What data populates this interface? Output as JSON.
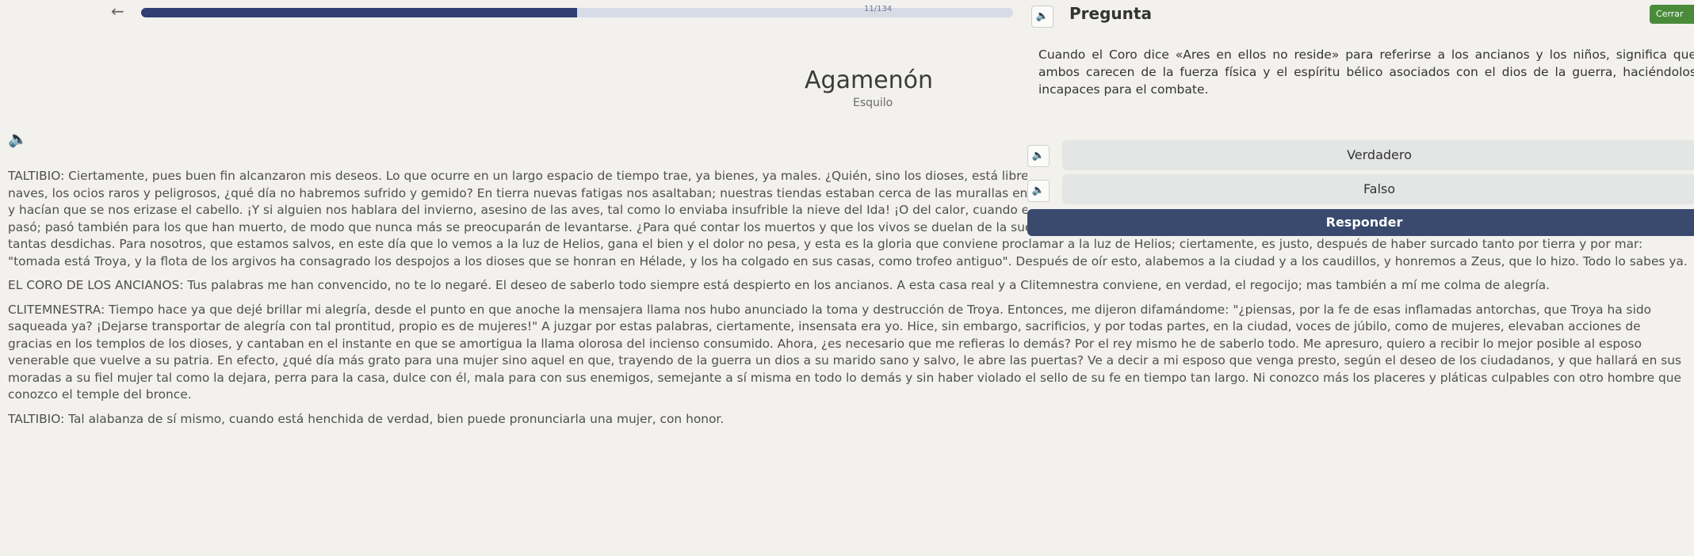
{
  "header": {
    "back_icon": "back-arrow-icon",
    "progress_text": "11/134",
    "progress": 0.5
  },
  "book": {
    "title": "Agamenón",
    "author": "Esquilo",
    "audio_icon": "speaker-icon",
    "paragraphs": [
      "TALTIBIO: Ciertamente, pues buen fin alcanzaron mis deseos. Lo que ocurre en un largo espacio de tiempo trae, ya bienes, ya males. ¿Quién, sino los dioses, está libre de dolor todo el tiempo de su vida? Si os contara nuestras fatigas y el mal acampar, los accidentes de las naves, los ocios raros y peligrosos, ¿qué día no habremos sufrido y gemido? En tierra nuevas fatigas nos asaltaban; nuestras tiendas estaban cerca de las murallas enemigas; del cielo y de la tierra, los rocíos de los prados nos empapaban, calamidad de nuestras vestiduras, y hacían que se nos erizase el cabello. ¡Y si alguien nos hablara del invierno, asesino de las aves, tal como lo enviaba insufrible la nieve del Ida! ¡O del calor, cuando el mar, abandonado por el viento, se dormía inmóvil en su lecho! Pero ¿para qué quejarse ya? El trabajo pasó; pasó también para los que han muerto, de modo que nunca más se preocuparán de levantarse. ¿Para qué contar los muertos y que los vivos se duelan de la suerte adversa? ¿De qué les sirve contarlo a los vivos? Antes conviene regocijarse de haber escapado de tantas desdichas. Para nosotros, que estamos salvos, en este día que lo vemos a la luz de Helios, gana el bien y el dolor no pesa, y esta es la gloria que conviene proclamar a la luz de Helios; ciertamente, es justo, después de haber surcado tanto por tierra y por mar: \"tomada está Troya, y la flota de los argivos ha consagrado los despojos a los dioses que se honran en Hélade, y los ha colgado en sus casas, como trofeo antiguo\". Después de oír esto, alabemos a la ciudad y a los caudillos, y honremos a Zeus, que lo hizo. Todo lo sabes ya.",
      "EL CORO DE LOS ANCIANOS: Tus palabras me han convencido, no te lo negaré. El deseo de saberlo todo siempre está despierto en los ancianos. A esta casa real y a Clitemnestra conviene, en verdad, el regocijo; mas también a mí me colma de alegría.",
      "CLITEMNESTRA: Tiempo hace ya que dejé brillar mi alegría, desde el punto en que anoche la mensajera llama nos hubo anunciado la toma y destrucción de Troya. Entonces, me dijeron difamándome: \"¿piensas, por la fe de esas inflamadas antorchas, que Troya ha sido saqueada ya? ¡Dejarse transportar de alegría con tal prontitud, propio es de mujeres!\" A juzgar por estas palabras, ciertamente, insensata era yo. Hice, sin embargo, sacrificios, y por todas partes, en la ciudad, voces de júbilo, como de mujeres, elevaban acciones de gracias en los templos de los dioses, y cantaban en el instante en que se amortigua la llama olorosa del incienso consumido. Ahora, ¿es necesario que me refieras lo demás? Por el rey mismo he de saberlo todo. Me apresuro, quiero a recibir lo mejor posible al esposo venerable que vuelve a su patria. En efecto, ¿qué día más grato para una mujer sino aquel en que, trayendo de la guerra un dios a su marido sano y salvo, le abre las puertas? Ve a decir a mi esposo que venga presto, según el deseo de los ciudadanos, y que hallará en sus moradas a su fiel mujer tal como la dejara, perra para la casa, dulce con él, mala para con sus enemigos, semejante a sí misma en todo lo demás y sin haber violado el sello de su fe en tiempo tan largo. Ni conozco más los placeres y pláticas culpables con otro hombre que conozco el temple del bronce.",
      "TALTIBIO: Tal alabanza de sí mismo, cuando está henchida de verdad, bien puede pronunciarla una mujer, con honor."
    ]
  },
  "question": {
    "audio_icon": "speaker-icon",
    "label": "Pregunta",
    "close_label": "Cerrar",
    "text": "Cuando el Coro dice «Ares en ellos no reside» para referirse a los ancianos y los niños, significa que ambos carecen de la fuerza física y el espíritu bélico asociados con el dios de la guerra, haciéndolos incapaces para el combate.",
    "options": [
      {
        "label": "Verdadero",
        "audio_icon": "speaker-icon"
      },
      {
        "label": "Falso",
        "audio_icon": "speaker-icon"
      }
    ],
    "respond_label": "Responder"
  }
}
